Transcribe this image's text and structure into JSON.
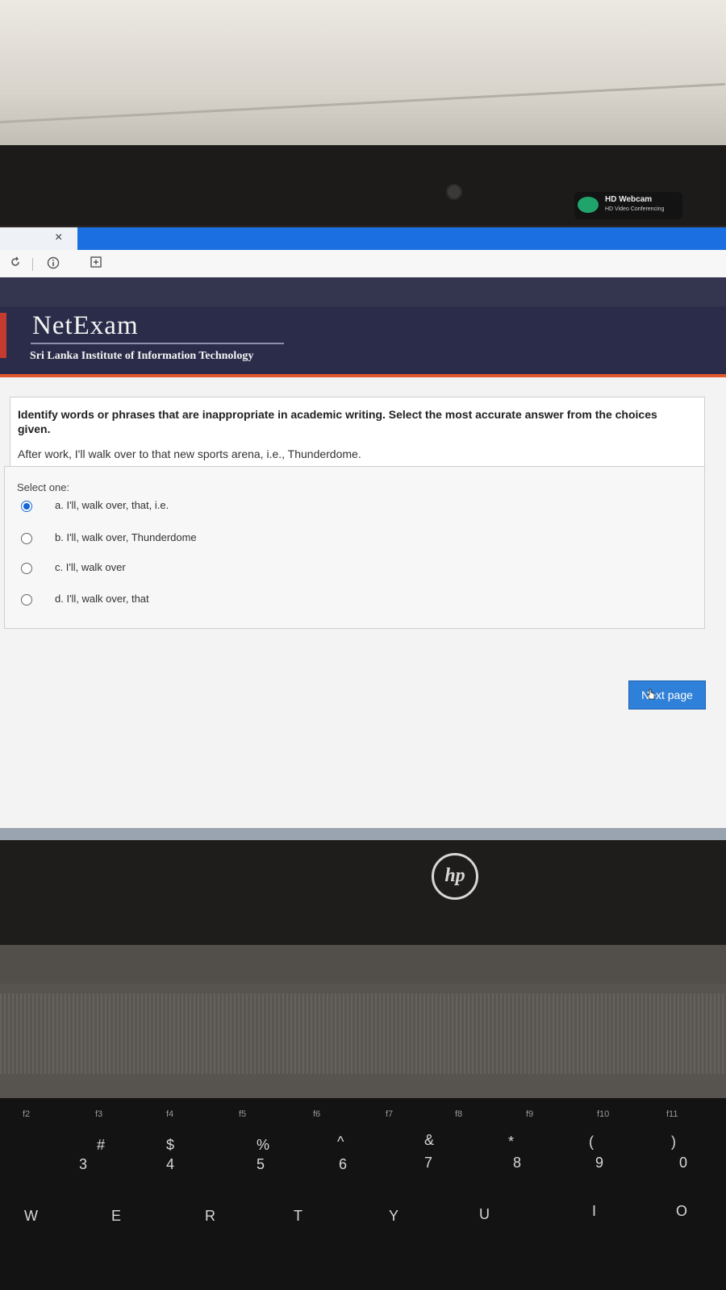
{
  "webcam": {
    "title": "HD Webcam",
    "subtitle": "HD Video Conferencing"
  },
  "browser": {
    "tab_close": "×",
    "reload_icon": "reload-icon",
    "info_icon": "info-icon",
    "extension_icon": "extension-icon"
  },
  "header": {
    "brand": "NetExam",
    "institute": "Sri Lanka Institute of Information Technology"
  },
  "question": {
    "prompt": "Identify words or phrases that are inappropriate in academic writing. Select the most accurate answer from the choices given.",
    "sentence": "After work, I'll walk over to that new sports arena, i.e., Thunderdome."
  },
  "answers": {
    "label": "Select one:",
    "selected_index": 0,
    "options": [
      "a. I'll, walk over, that, i.e.",
      "b. I'll, walk over, Thunderdome",
      "c. I'll, walk over",
      "d. I'll, walk over, that"
    ]
  },
  "nav": {
    "next_label": "Next page"
  },
  "laptop": {
    "logo": "hp"
  },
  "keyboard": {
    "fkeys": [
      "f2",
      "f3",
      "f4",
      "f5",
      "f6",
      "f7",
      "f8",
      "f9",
      "f10",
      "f11"
    ],
    "numbers": [
      "3",
      "4",
      "5",
      "6",
      "7",
      "8",
      "9",
      "0"
    ],
    "symbols": [
      "#",
      "$",
      "%",
      "^",
      "&",
      "*",
      "(",
      ")"
    ],
    "letters": [
      "W",
      "E",
      "R",
      "T",
      "Y",
      "U",
      "I",
      "O"
    ]
  },
  "colors": {
    "accent": "#2f80d8",
    "header_bg": "#2b2c49",
    "header_stripe": "#e2582c",
    "tabbar": "#1c6fe0"
  }
}
